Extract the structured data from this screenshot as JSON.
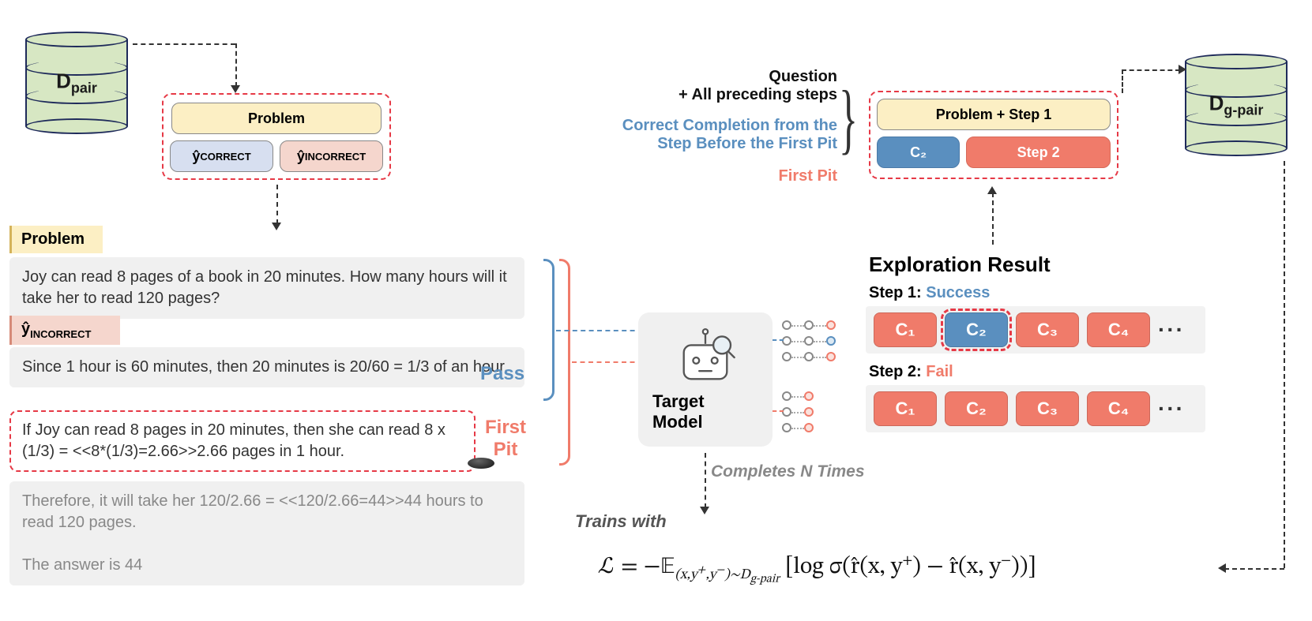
{
  "db_left_label_html": "D<sub>pair</sub>",
  "db_right_label_html": "D<sub>g-pair</sub>",
  "sample_box": {
    "problem": "Problem",
    "y_correct_html": "ŷ<sub class='sub-label'>CORRECT</sub>",
    "y_incorrect_html": "ŷ<sub class='sub-label'>INCORRECT</sub>"
  },
  "left_panel": {
    "problem_header": "Problem",
    "problem_text": "Joy can read 8 pages of a book in 20 minutes. How many hours will it take her to read 120 pages?",
    "y_header_html": "ŷ<sub class='sub-label'>INCORRECT</sub>",
    "step1": "Since 1 hour is 60 minutes, then 20 minutes is 20/60 = 1/3 of an hour.",
    "step2": "If Joy can read 8 pages in 20 minutes, then she can read 8 x (1/3) = <<8*(1/3)=2.66>>2.66 pages in 1 hour.",
    "rest": "Therefore, it will take her 120/2.66 = <<120/2.66=44>>44 hours to read 120 pages.\n\nThe answer is 44",
    "pass": "Pass",
    "first_pit": "First\nPit"
  },
  "annotations": {
    "line1": "Question",
    "line1b": "+ All preceding steps",
    "line2": "Correct Completion from the",
    "line2b": "Step Before the First Pit",
    "line3": "First Pit"
  },
  "new_sample": {
    "top": "Problem + Step 1",
    "c2": "C₂",
    "step2": "Step 2"
  },
  "target_model": "Target Model",
  "completes_n": "Completes N Times",
  "exploration_title": "Exploration Result",
  "step1_label": "Step 1:",
  "step1_status": "Success",
  "step2_label": "Step 2:",
  "step2_status": "Fail",
  "chips": [
    "C₁",
    "C₂",
    "C₃",
    "C₄"
  ],
  "trains_with": "Trains with",
  "formula_html": "ℒ = −𝔼<span class='sub'>(x,y<sup>+</sup>,y<sup>−</sup>)∼D<sub>g-pair</sub></span> [log σ(r̂(x, y<span class='sup'>+</span>) − r̂(x, y<span class='sup'>−</span>))]"
}
